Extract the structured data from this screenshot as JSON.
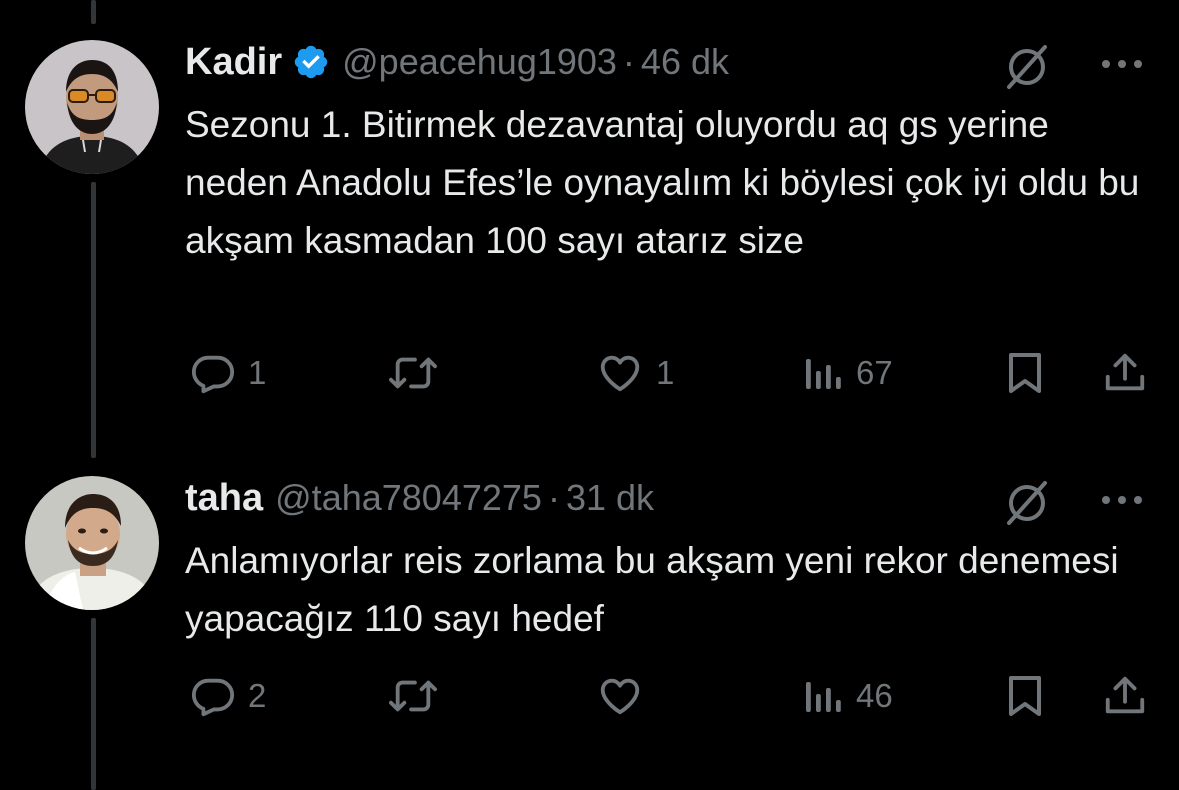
{
  "tweets": [
    {
      "name": "Kadir",
      "verified": true,
      "handle": "@peacehug1903",
      "separator": "·",
      "time": "46 dk",
      "text": "Sezonu 1. Bitirmek dezavantaj oluyordu aq gs yerine neden Anadolu Efes’le oynayalım ki böylesi çok iyi oldu bu akşam kasmadan 100 sayı atarız size",
      "replies": "1",
      "retweets": "",
      "likes": "1",
      "views": "67"
    },
    {
      "name": "taha",
      "verified": false,
      "handle": "@taha78047275",
      "separator": "·",
      "time": "31 dk",
      "text": "Anlamıyorlar reis zorlama bu akşam yeni rekor denemesi yapacağız 110 sayı hedef",
      "replies": "2",
      "retweets": "",
      "likes": "",
      "views": "46"
    }
  ],
  "icons": {
    "verified_badge": "verified-badge-icon",
    "grok": "grok-icon",
    "more": "more-dots-icon",
    "reply": "reply-icon",
    "retweet": "retweet-icon",
    "like": "heart-icon",
    "views": "views-icon",
    "bookmark": "bookmark-icon",
    "share": "share-icon"
  },
  "colors": {
    "background": "#000000",
    "primary_text": "#e7e9ea",
    "secondary_text": "#71767b",
    "verified_blue": "#1d9bf0",
    "thread_line": "#333639"
  }
}
